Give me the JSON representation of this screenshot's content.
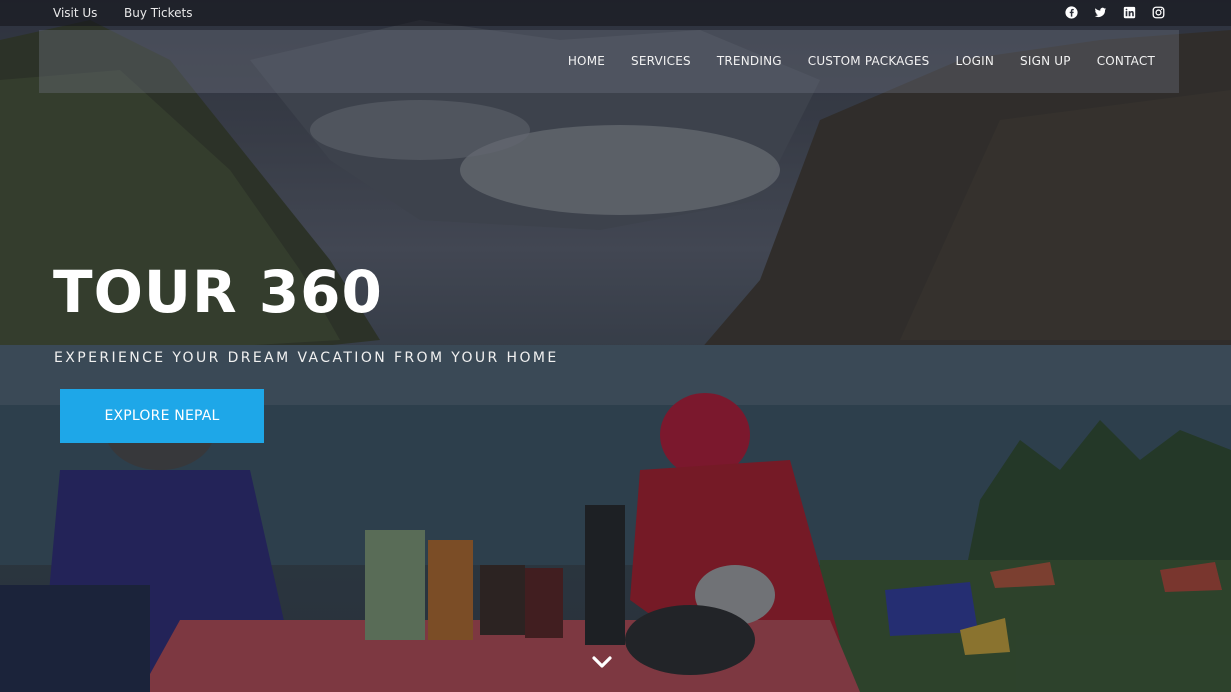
{
  "topbar": {
    "links": [
      "Visit Us",
      "Buy Tickets"
    ],
    "social_icons": [
      "facebook-icon",
      "twitter-icon",
      "linkedin-icon",
      "instagram-icon"
    ]
  },
  "nav": {
    "items": [
      "HOME",
      "SERVICES",
      "TRENDING",
      "CUSTOM PACKAGES",
      "LOGIN",
      "SIGN UP",
      "CONTACT"
    ]
  },
  "hero": {
    "title": "TOUR 360",
    "subtitle": "EXPERIENCE YOUR DREAM VACATION FROM YOUR HOME",
    "cta_label": "EXPLORE NEPAL",
    "scroll_icon": "chevron-down-icon"
  },
  "colors": {
    "accent": "#1ea7e8"
  }
}
